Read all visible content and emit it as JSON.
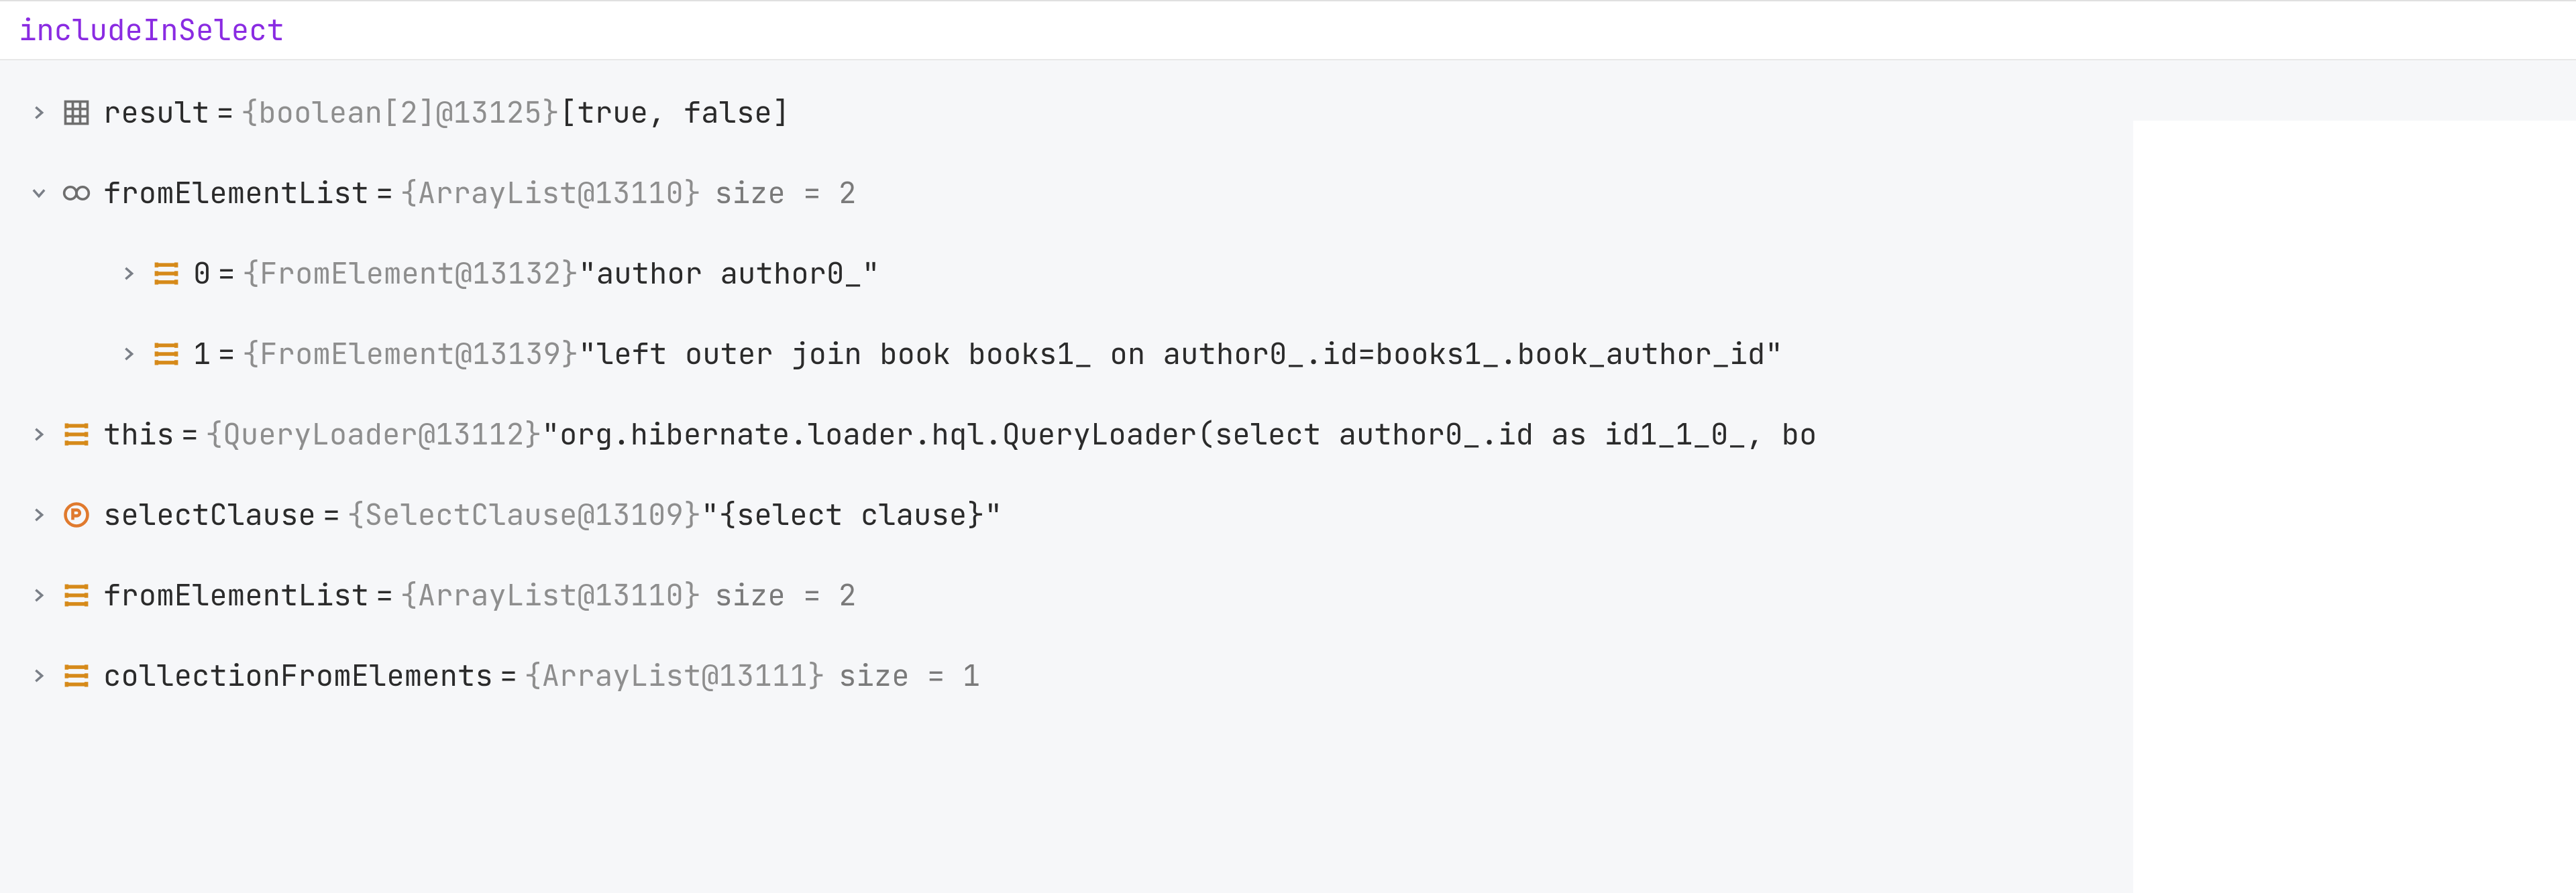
{
  "header": {
    "title": "includeInSelect"
  },
  "rows": [
    {
      "indent": 1,
      "expanded": false,
      "icon": "grid",
      "name": "result",
      "type": "{boolean[2]@13125}",
      "value": " [true, false]"
    },
    {
      "indent": 1,
      "expanded": true,
      "icon": "watch",
      "name": "fromElementList",
      "type": "{ArrayList@13110}",
      "size": "size = 2"
    },
    {
      "indent": 2,
      "expanded": false,
      "icon": "list",
      "name": "0",
      "type": "{FromElement@13132}",
      "value": " \"author author0_\""
    },
    {
      "indent": 2,
      "expanded": false,
      "icon": "list",
      "name": "1",
      "type": "{FromElement@13139}",
      "value": " \"left outer join book books1_ on author0_.id=books1_.book_author_id\""
    },
    {
      "indent": 1,
      "expanded": false,
      "icon": "list",
      "name": "this",
      "type": "{QueryLoader@13112}",
      "value": " \"org.hibernate.loader.hql.QueryLoader(select author0_.id as id1_1_0_, bo"
    },
    {
      "indent": 1,
      "expanded": false,
      "icon": "property",
      "name": "selectClause",
      "type": "{SelectClause@13109}",
      "value": " \"{select clause}\""
    },
    {
      "indent": 1,
      "expanded": false,
      "icon": "list",
      "name": "fromElementList",
      "type": "{ArrayList@13110}",
      "size": "size = 2"
    },
    {
      "indent": 1,
      "expanded": false,
      "icon": "list",
      "name": "collectionFromElements",
      "type": "{ArrayList@13111}",
      "size": "size = 1"
    }
  ]
}
